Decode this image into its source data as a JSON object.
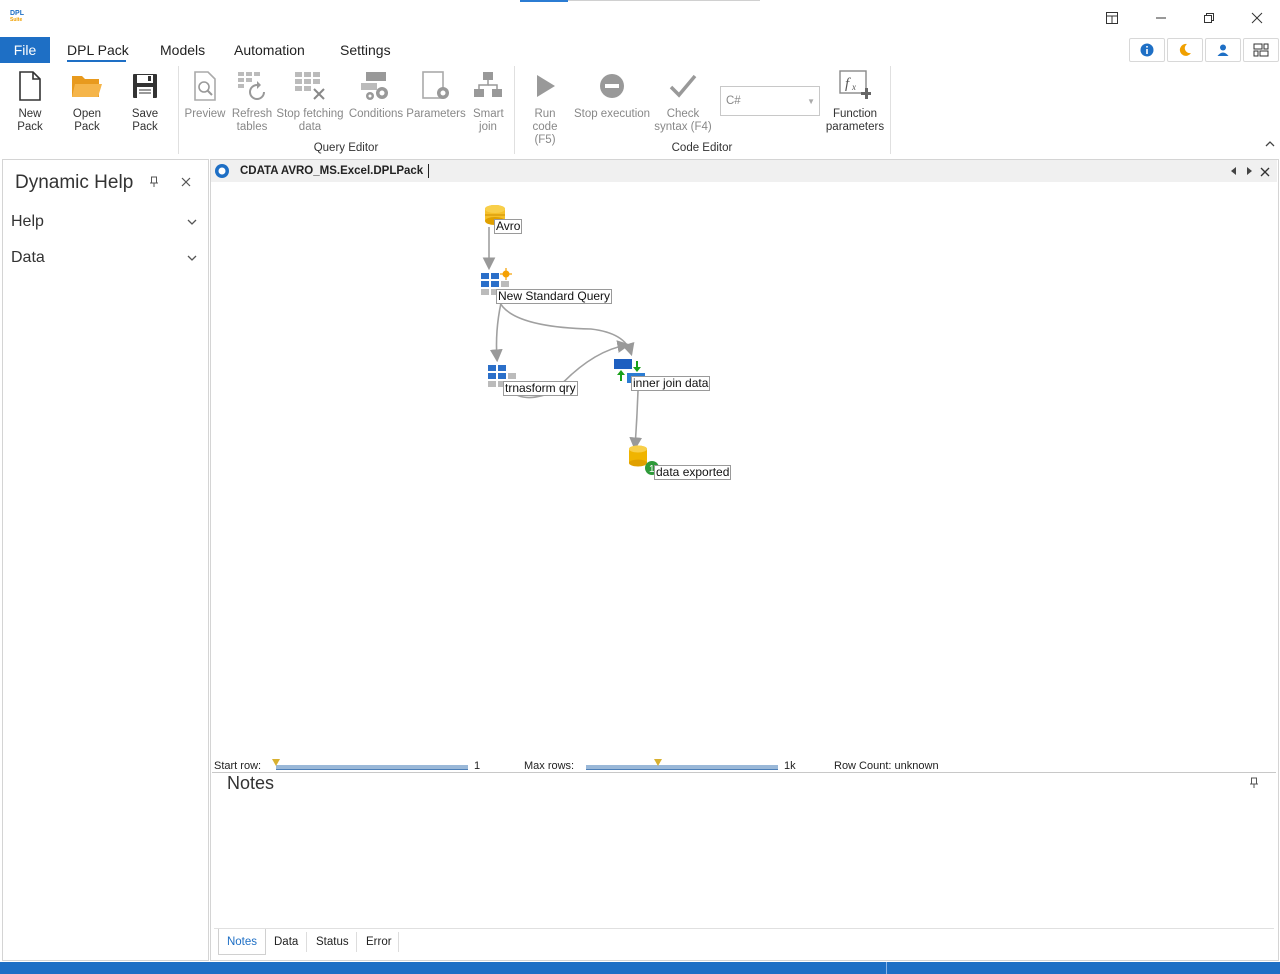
{
  "app": {
    "logo_line1": "DPL",
    "logo_line2": "Suite"
  },
  "menu": {
    "file": "File",
    "tabs": [
      "DPL Pack",
      "Models",
      "Automation",
      "Settings"
    ]
  },
  "ribbon": {
    "buttons": {
      "new_pack": "New Pack",
      "open_pack": "Open Pack",
      "save_pack": "Save Pack",
      "preview": "Preview",
      "refresh_tables": "Refresh tables",
      "stop_fetching": "Stop fetching data",
      "conditions": "Conditions",
      "parameters": "Parameters",
      "smart_join": "Smart join",
      "run_code": "Run code (F5)",
      "stop_execution": "Stop execution",
      "check_syntax": "Check syntax (F4)",
      "function_parameters": "Function parameters"
    },
    "language_select": "C#",
    "groups": {
      "query_editor": "Query Editor",
      "code_editor": "Code Editor"
    }
  },
  "left_panel": {
    "title": "Dynamic Help",
    "sections": [
      "Help",
      "Data"
    ]
  },
  "document": {
    "tab_title": "CDATA AVRO_MS.Excel.DPLPack",
    "nodes": {
      "avro": "Avro",
      "query": "New Standard Query",
      "transform": "trnasform qry",
      "join": "inner join data",
      "export": "data exported"
    },
    "bottom": {
      "start_row_label": "Start row:",
      "start_row_value": "1",
      "max_rows_label": "Max rows:",
      "max_rows_value": "1k",
      "row_count": "Row Count: unknown"
    }
  },
  "notes_panel": {
    "title": "Notes",
    "tabs": [
      "Notes",
      "Data",
      "Status",
      "Error"
    ]
  },
  "colors": {
    "accent": "#1e6fc5",
    "db_yellow": "#f0b400",
    "grid_blue": "#2b6fc9"
  }
}
